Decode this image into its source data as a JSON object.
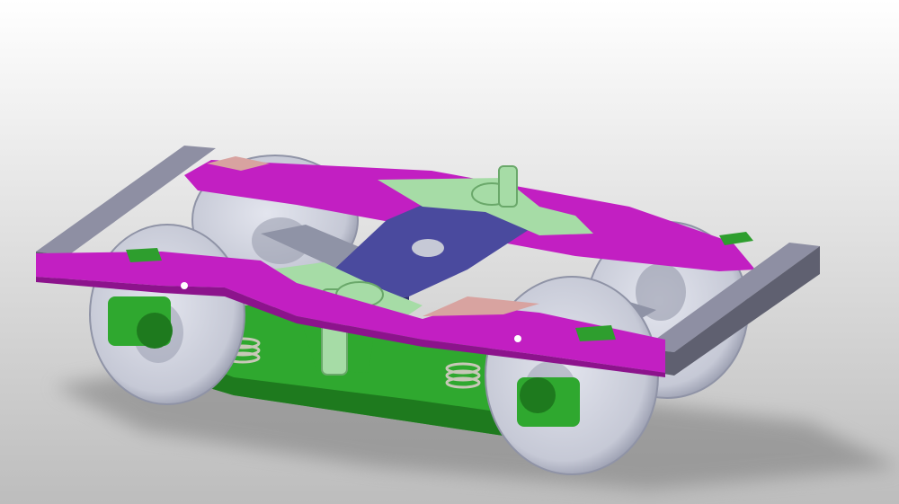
{
  "scene": {
    "colors": {
      "bg_top": "#ffffff",
      "bg_bottom": "#bdbdbd",
      "frame_gray": "#8e8fa3",
      "frame_gray_dark": "#5f6070",
      "side_magenta": "#c21fc2",
      "side_magenta_dark": "#8c138c",
      "pad_pink": "#d8a3a0",
      "pad_green": "#2e9e2e",
      "wheel": "#c6c9d6",
      "wheel_dark": "#8f93a6",
      "bolster_green": "#2fa82f",
      "bolster_green_dark": "#1e7a1e",
      "link_mint": "#a6dca6",
      "link_mint_dark": "#6aa86a",
      "plate_blue": "#4a4a9e",
      "plate_blue_dark": "#2f2f70",
      "spring": "#c8c8b8",
      "shadow": "#7a7a7a"
    }
  }
}
